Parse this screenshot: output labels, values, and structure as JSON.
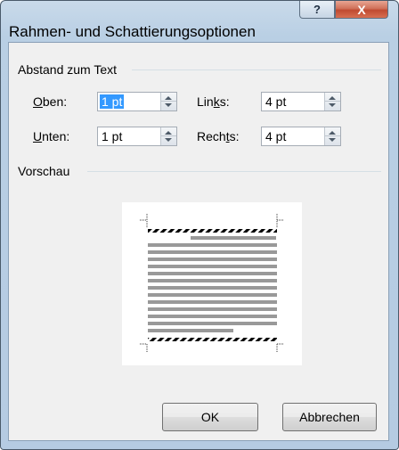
{
  "window": {
    "title": "Rahmen- und Schattierungsoptionen",
    "help_label": "?",
    "close_label": "X"
  },
  "group_distance": {
    "title": "Abstand zum Text"
  },
  "fields": {
    "top": {
      "label_ul": "O",
      "label_rest": "ben:",
      "value": "1 pt"
    },
    "bottom": {
      "label_ul": "U",
      "label_rest": "nten:",
      "value": "1 pt"
    },
    "left": {
      "label_pre": "Lin",
      "label_ul": "k",
      "label_rest": "s:",
      "value": "4 pt"
    },
    "right": {
      "label_pre": "Rech",
      "label_ul": "t",
      "label_rest": "s:",
      "value": "4 pt"
    }
  },
  "group_preview": {
    "title": "Vorschau"
  },
  "buttons": {
    "ok": "OK",
    "cancel": "Abbrechen"
  },
  "colors": {
    "selection": "#3399ff",
    "frame": "#b5cbe2",
    "close": "#c04a31"
  }
}
